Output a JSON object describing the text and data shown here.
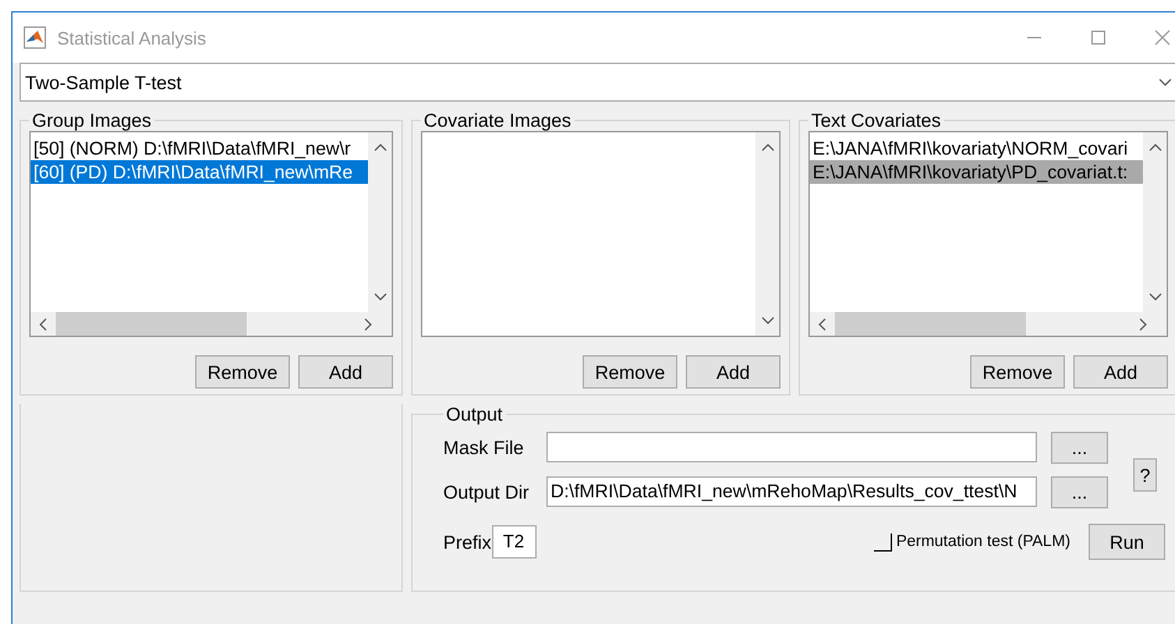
{
  "window": {
    "title": "Statistical Analysis"
  },
  "test_type": {
    "value": "Two-Sample T-test"
  },
  "panels": [
    {
      "title": "Group Images",
      "focused": true,
      "horizontal_scrollbar": true,
      "items": [
        {
          "label": "[50] (NORM) D:\\fMRI\\Data\\fMRI_new\\r",
          "selected": false
        },
        {
          "label": "[60] (PD) D:\\fMRI\\Data\\fMRI_new\\mRe",
          "selected": true
        }
      ],
      "buttons": [
        "Remove",
        "Add"
      ]
    },
    {
      "title": "Covariate Images",
      "horizontal_scrollbar": false,
      "buttons": [
        "Remove",
        "Add"
      ]
    },
    {
      "title": "Text Covariates",
      "focused": false,
      "horizontal_scrollbar": true,
      "items": [
        {
          "label": "E:\\JANA\\fMRI\\kovariaty\\NORM_covari",
          "selected": false
        },
        {
          "label": "E:\\JANA\\fMRI\\kovariaty\\PD_covariat.t:",
          "selected": true
        }
      ],
      "buttons": [
        "Remove",
        "Add"
      ]
    }
  ],
  "output": {
    "title": "Output",
    "mask_file": {
      "label": "Mask File",
      "browse": "..."
    },
    "output_dir": {
      "label": "Output Dir",
      "value": "D:\\fMRI\\Data\\fMRI_new\\mRehoMap\\Results_cov_ttest\\N",
      "browse": "..."
    },
    "help": "?",
    "prefix": {
      "label": "Prefix",
      "value": "T2"
    },
    "permutation": {
      "label": "Permutation test (PALM)",
      "checked": false
    },
    "run": "Run"
  }
}
